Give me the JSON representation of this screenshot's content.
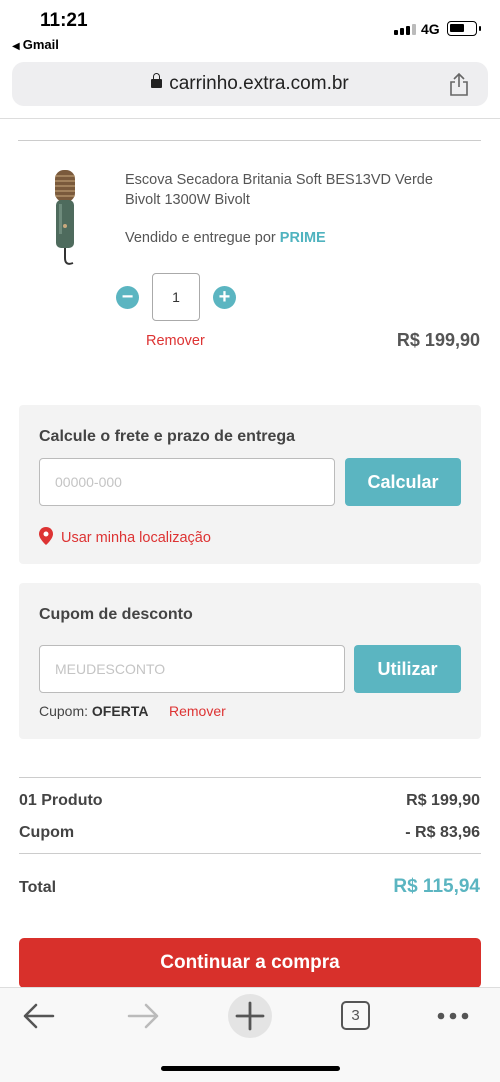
{
  "status_bar": {
    "time": "11:21",
    "back_app": "Gmail",
    "network": "4G"
  },
  "browser": {
    "url": "carrinho.extra.com.br",
    "tab_count": "3"
  },
  "product": {
    "name": "Escova Secadora Britania Soft BES13VD Verde Bivolt 1300W Bivolt",
    "seller_prefix": "Vendido e entregue por",
    "seller_name": "PRIME",
    "quantity": "1",
    "remove_label": "Remover",
    "price": "R$ 199,90"
  },
  "freight": {
    "title": "Calcule o frete e prazo de entrega",
    "cep_placeholder": "00000-000",
    "button_label": "Calcular",
    "location_label": "Usar minha localização"
  },
  "coupon": {
    "title": "Cupom de desconto",
    "placeholder": "MEUDESCONTO",
    "button_label": "Utilizar",
    "applied_label": "Cupom:",
    "applied_code": "OFERTA",
    "remove_label": "Remover"
  },
  "summary": {
    "products_label": "01 Produto",
    "products_value": "R$ 199,90",
    "coupon_label": "Cupom",
    "coupon_value": "- R$ 83,96",
    "total_label": "Total",
    "total_value": "R$ 115,94"
  },
  "checkout": {
    "continue_label": "Continuar a compra"
  },
  "colors": {
    "accent_teal": "#5bb5c1",
    "action_red": "#d8302b",
    "link_red": "#dd3333"
  }
}
